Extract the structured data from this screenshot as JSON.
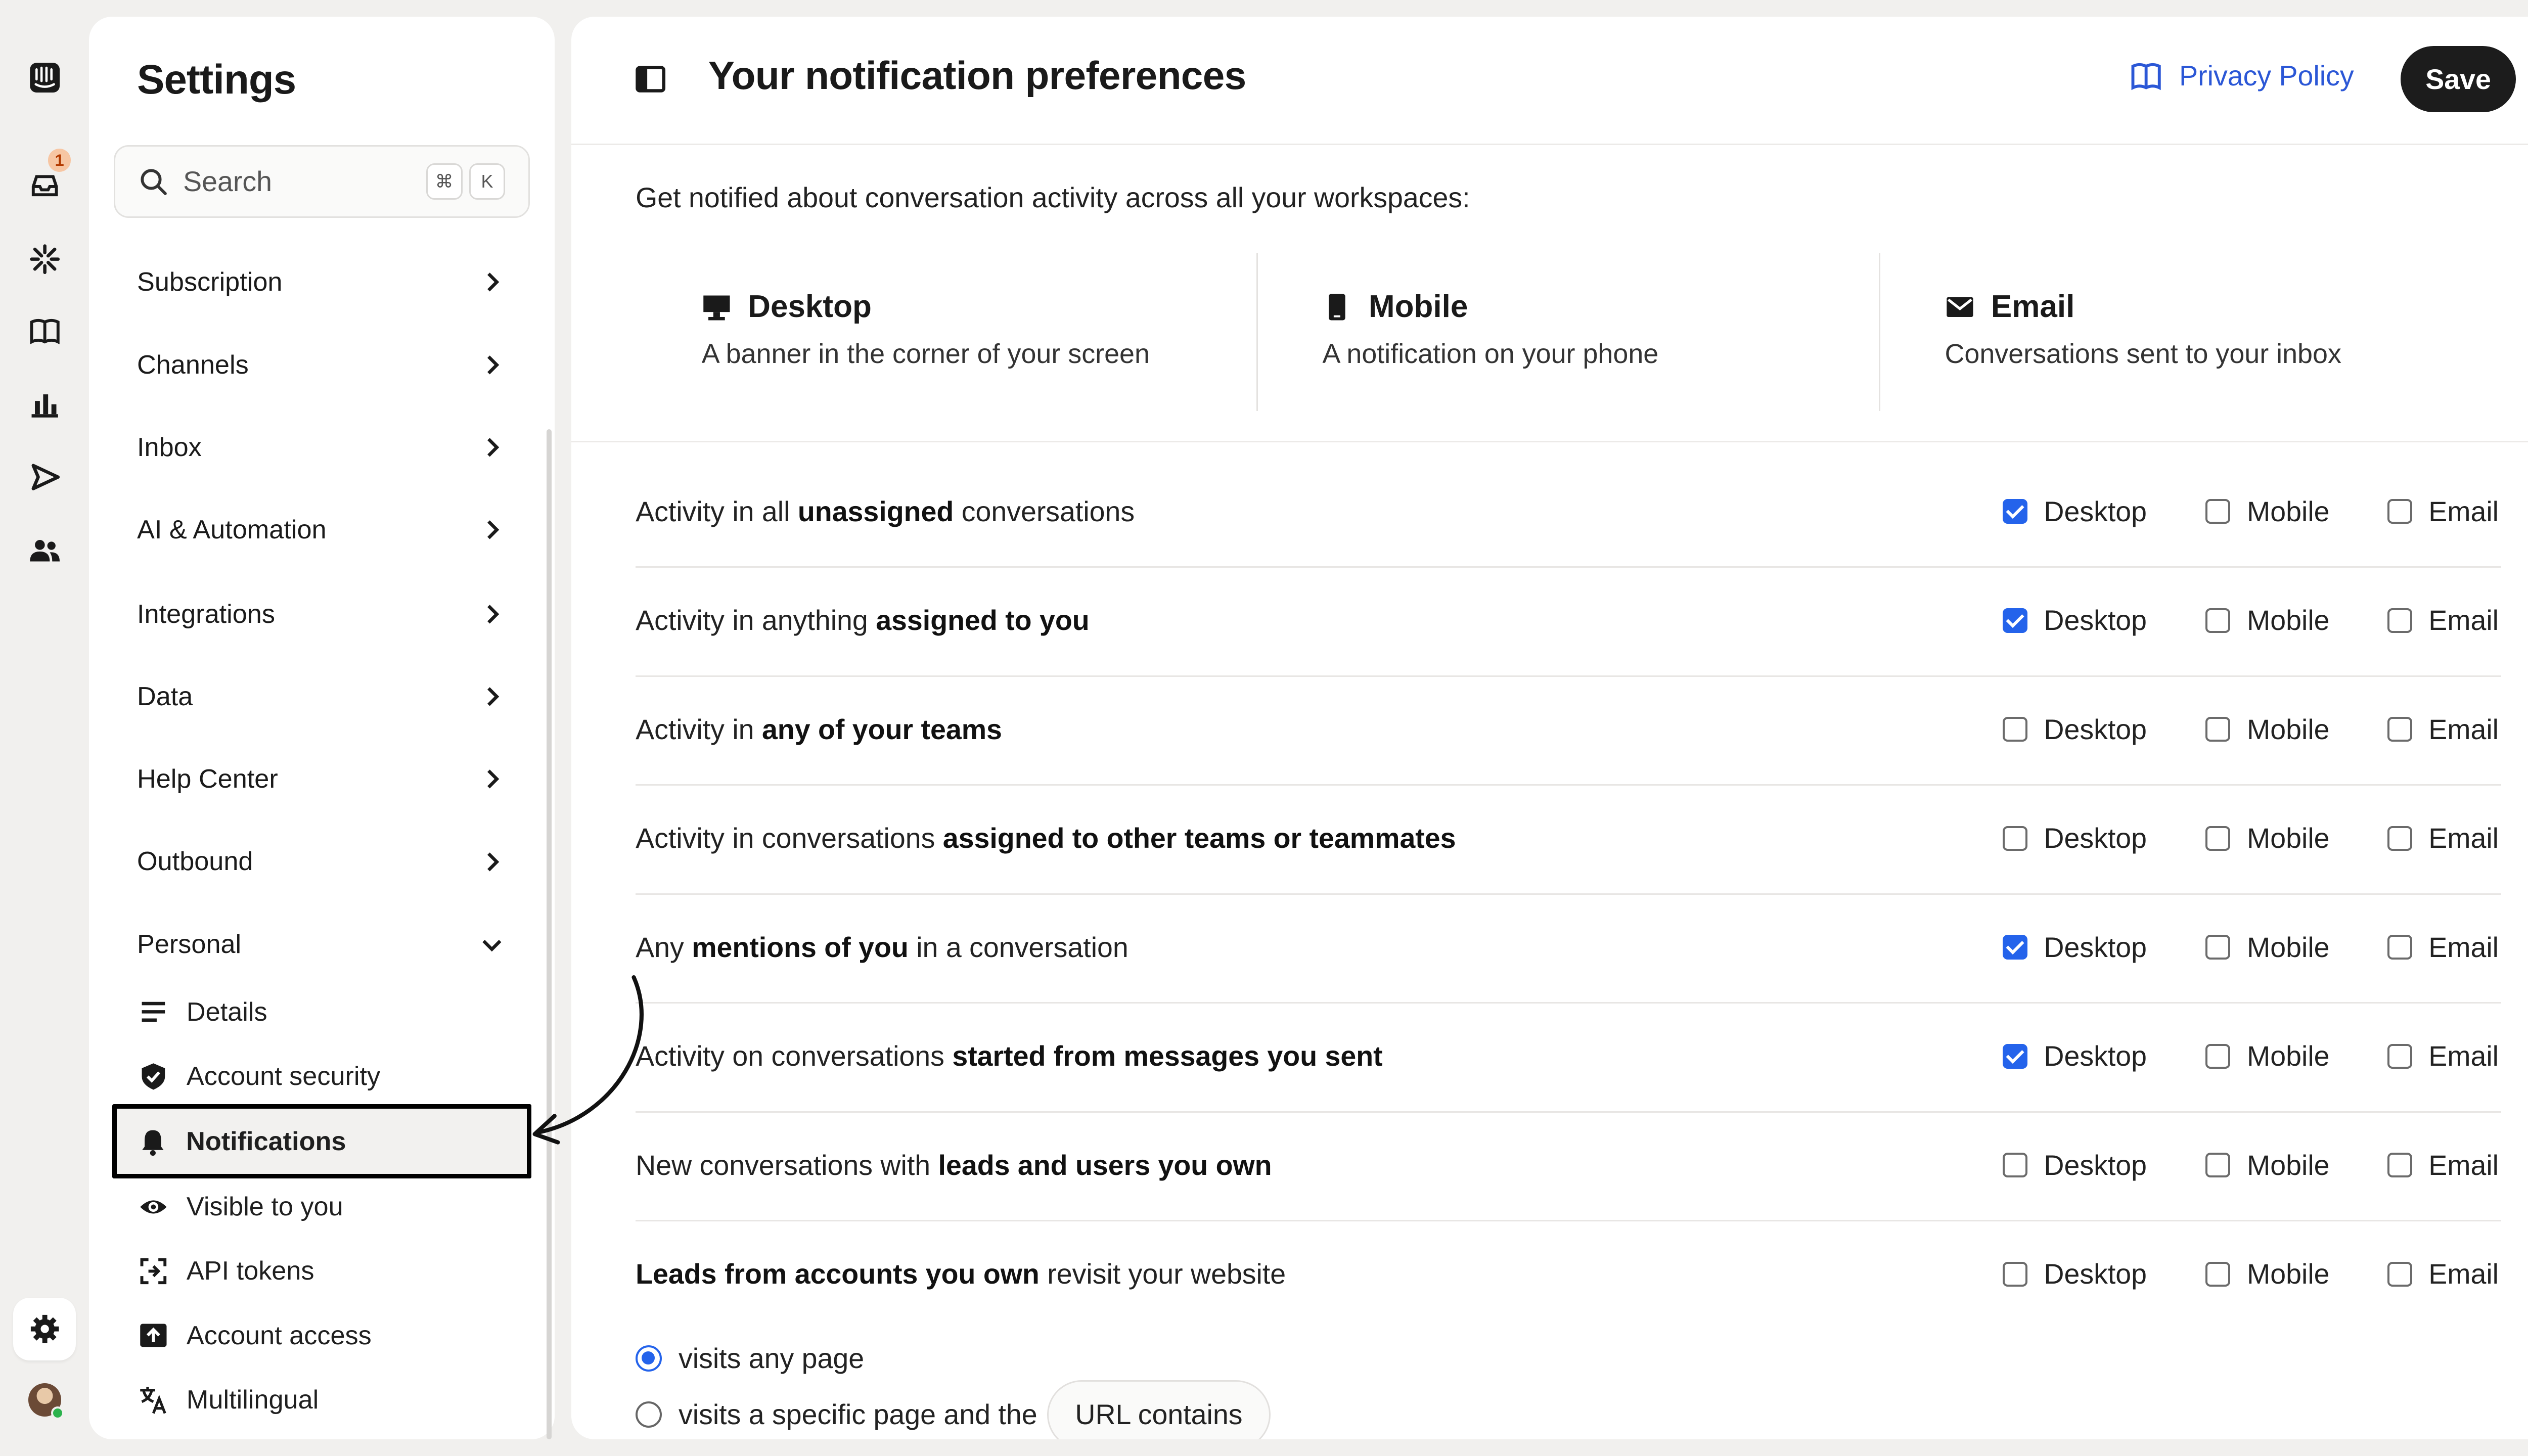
{
  "rail": {
    "inbox_badge": "1"
  },
  "sidebar": {
    "title": "Settings",
    "search": {
      "placeholder": "Search",
      "kbd1": "⌘",
      "kbd2": "K"
    },
    "items": [
      {
        "label": "Subscription"
      },
      {
        "label": "Channels"
      },
      {
        "label": "Inbox"
      },
      {
        "label": "AI & Automation"
      },
      {
        "label": "Integrations"
      },
      {
        "label": "Data"
      },
      {
        "label": "Help Center"
      },
      {
        "label": "Outbound"
      },
      {
        "label": "Personal"
      }
    ],
    "personal": [
      {
        "label": "Details",
        "icon": "lines-icon"
      },
      {
        "label": "Account security",
        "icon": "shield-check-icon"
      },
      {
        "label": "Notifications",
        "icon": "bell-icon",
        "active": true
      },
      {
        "label": "Visible to you",
        "icon": "eye-icon"
      },
      {
        "label": "API tokens",
        "icon": "api-icon"
      },
      {
        "label": "Account access",
        "icon": "upload-box-icon"
      },
      {
        "label": "Multilingual",
        "icon": "translate-icon"
      }
    ]
  },
  "header": {
    "title": "Your notification preferences",
    "privacy_label": "Privacy Policy",
    "save_label": "Save"
  },
  "intro": "Get notified about conversation activity across all your workspaces:",
  "channels": [
    {
      "name": "Desktop",
      "desc": "A banner in the corner of your screen"
    },
    {
      "name": "Mobile",
      "desc": "A notification on your phone"
    },
    {
      "name": "Email",
      "desc": "Conversations sent to your inbox"
    }
  ],
  "option_labels": {
    "desktop": "Desktop",
    "mobile": "Mobile",
    "email": "Email"
  },
  "rows": [
    {
      "pre": "Activity in all ",
      "bold": "unassigned",
      "post": " conversations",
      "desktop": true,
      "mobile": false,
      "email": false
    },
    {
      "pre": "Activity in anything ",
      "bold": "assigned to you",
      "post": "",
      "desktop": true,
      "mobile": false,
      "email": false
    },
    {
      "pre": "Activity in ",
      "bold": "any of your teams",
      "post": "",
      "desktop": false,
      "mobile": false,
      "email": false
    },
    {
      "pre": "Activity in conversations ",
      "bold": "assigned to other teams or teammates",
      "post": "",
      "desktop": false,
      "mobile": false,
      "email": false
    },
    {
      "pre": "Any ",
      "bold": "mentions of you",
      "post": " in a conversation",
      "desktop": true,
      "mobile": false,
      "email": false
    },
    {
      "pre": "Activity on conversations ",
      "bold": "started from messages you sent",
      "post": "",
      "desktop": true,
      "mobile": false,
      "email": false
    },
    {
      "pre": "New conversations with ",
      "bold": "leads and users you own",
      "post": "",
      "desktop": false,
      "mobile": false,
      "email": false
    },
    {
      "pre": "",
      "bold": "Leads from accounts you own",
      "post": " revisit your website",
      "desktop": false,
      "mobile": false,
      "email": false
    }
  ],
  "radios": {
    "option1": "visits any page",
    "option2": "visits a specific page and the",
    "pill": "URL contains"
  }
}
